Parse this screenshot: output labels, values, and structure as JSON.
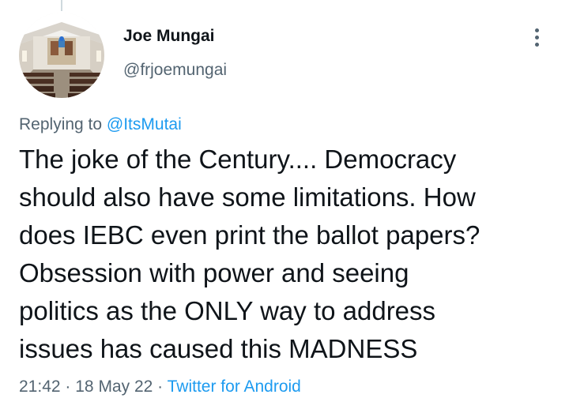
{
  "tweet": {
    "author": {
      "name": "Joe Mungai",
      "handle": "@frjoemungai"
    },
    "replying_prefix": "Replying to",
    "replying_to": "@ItsMutai",
    "text_lines": [
      "The joke of the Century.... Democracy",
      "should also have some limitations. How",
      "does IEBC even print the ballot papers?",
      "Obsession with power and seeing",
      "politics as the ONLY way to address",
      "issues has caused this MADNESS"
    ],
    "time": "21:42",
    "separator": "·",
    "date": "18 May 22",
    "source": "Twitter for Android"
  },
  "icons": {
    "more": "more-vertical-icon",
    "avatar": "church-interior-photo"
  },
  "colors": {
    "text": "#0f1419",
    "secondary": "#536471",
    "link": "#1d9bf0"
  }
}
